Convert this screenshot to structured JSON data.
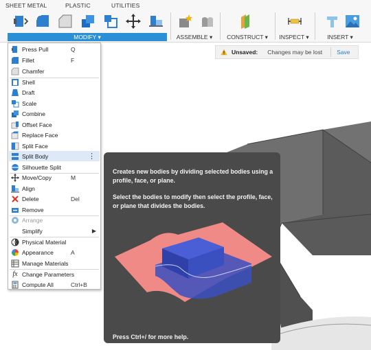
{
  "ribbon": {
    "tabs": [
      "SHEET METAL",
      "PLASTIC",
      "UTILITIES"
    ],
    "groups": {
      "modify": "MODIFY ▾",
      "assemble": "ASSEMBLE ▾",
      "construct": "CONSTRUCT ▾",
      "inspect": "INSPECT ▾",
      "insert": "INSERT ▾"
    }
  },
  "status": {
    "label": "Unsaved:",
    "message": "Changes may be lost",
    "save": "Save"
  },
  "menu": {
    "items": [
      {
        "label": "Press Pull",
        "shortcut": "Q",
        "icon": "press-pull-icon"
      },
      {
        "label": "Fillet",
        "shortcut": "F",
        "icon": "fillet-icon"
      },
      {
        "label": "Chamfer",
        "shortcut": "",
        "icon": "chamfer-icon"
      },
      {
        "label": "Shell",
        "shortcut": "",
        "icon": "shell-icon"
      },
      {
        "label": "Draft",
        "shortcut": "",
        "icon": "draft-icon"
      },
      {
        "label": "Scale",
        "shortcut": "",
        "icon": "scale-icon"
      },
      {
        "label": "Combine",
        "shortcut": "",
        "icon": "combine-icon"
      },
      {
        "label": "Offset Face",
        "shortcut": "",
        "icon": "offset-face-icon"
      },
      {
        "label": "Replace Face",
        "shortcut": "",
        "icon": "replace-face-icon"
      },
      {
        "label": "Split Face",
        "shortcut": "",
        "icon": "split-face-icon"
      },
      {
        "label": "Split Body",
        "shortcut": "",
        "icon": "split-body-icon"
      },
      {
        "label": "Silhouette Split",
        "shortcut": "",
        "icon": "silhouette-split-icon"
      },
      {
        "label": "Move/Copy",
        "shortcut": "M",
        "icon": "move-icon"
      },
      {
        "label": "Align",
        "shortcut": "",
        "icon": "align-icon"
      },
      {
        "label": "Delete",
        "shortcut": "Del",
        "icon": "delete-icon"
      },
      {
        "label": "Remove",
        "shortcut": "",
        "icon": "remove-icon"
      },
      {
        "label": "Arrange",
        "shortcut": "",
        "icon": "arrange-icon"
      },
      {
        "label": "Simplify",
        "shortcut": "",
        "icon": ""
      },
      {
        "label": "Physical Material",
        "shortcut": "",
        "icon": "physical-material-icon"
      },
      {
        "label": "Appearance",
        "shortcut": "A",
        "icon": "appearance-icon"
      },
      {
        "label": "Manage Materials",
        "shortcut": "",
        "icon": "manage-materials-icon"
      },
      {
        "label": "Change Parameters",
        "shortcut": "",
        "icon": "fx-icon"
      },
      {
        "label": "Compute All",
        "shortcut": "Ctrl+B",
        "icon": "compute-all-icon"
      }
    ],
    "more_glyph": "⋮",
    "submenu_glyph": "▶",
    "fx_glyph": "fx"
  },
  "tooltip": {
    "line1": "Creates new bodies by dividing selected bodies using a profile, face, or plane.",
    "line2": "Select the bodies to modify then select the profile, face, or plane that divides the bodies.",
    "footer": "Press Ctrl+/ for more help."
  },
  "colors": {
    "accent": "#2b8fd6",
    "viewport_bg": "#ffffff",
    "model_top": "#6e6e6e",
    "model_side": "#4f4f4f",
    "tooltip_bg": "#4a4a4a",
    "illustration_plane": "#f08a86",
    "illustration_body": "#3a4fc0"
  }
}
